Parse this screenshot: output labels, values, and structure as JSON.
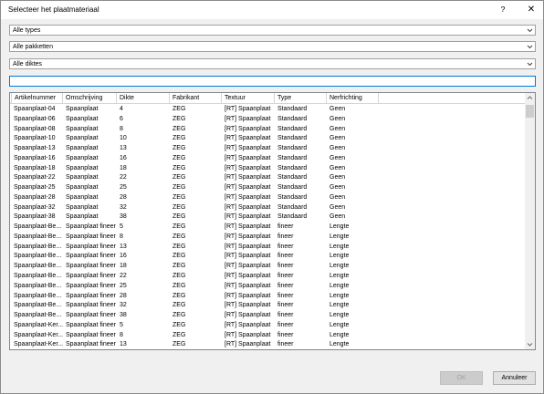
{
  "window": {
    "title": "Selecteer het plaatmateriaal",
    "help_label": "?",
    "close_label": "✕"
  },
  "filters": {
    "types": "Alle types",
    "packages": "Alle pakketten",
    "thickness": "Alle diktes"
  },
  "search": {
    "value": ""
  },
  "table": {
    "columns": [
      "Artikelnummer",
      "Omschrijving",
      "Dikte",
      "Fabrikant",
      "Textuur",
      "Type",
      "Nerfrichting"
    ],
    "rows": [
      [
        "Spaanplaat-04",
        "Spaanplaat",
        "4",
        "ZEG",
        "[RT] Spaanplaat",
        "Standaard",
        "Geen"
      ],
      [
        "Spaanplaat-06",
        "Spaanplaat",
        "6",
        "ZEG",
        "[RT] Spaanplaat",
        "Standaard",
        "Geen"
      ],
      [
        "Spaanplaat-08",
        "Spaanplaat",
        "8",
        "ZEG",
        "[RT] Spaanplaat",
        "Standaard",
        "Geen"
      ],
      [
        "Spaanplaat-10",
        "Spaanplaat",
        "10",
        "ZEG",
        "[RT] Spaanplaat",
        "Standaard",
        "Geen"
      ],
      [
        "Spaanplaat-13",
        "Spaanplaat",
        "13",
        "ZEG",
        "[RT] Spaanplaat",
        "Standaard",
        "Geen"
      ],
      [
        "Spaanplaat-16",
        "Spaanplaat",
        "16",
        "ZEG",
        "[RT] Spaanplaat",
        "Standaard",
        "Geen"
      ],
      [
        "Spaanplaat-18",
        "Spaanplaat",
        "18",
        "ZEG",
        "[RT] Spaanplaat",
        "Standaard",
        "Geen"
      ],
      [
        "Spaanplaat-22",
        "Spaanplaat",
        "22",
        "ZEG",
        "[RT] Spaanplaat",
        "Standaard",
        "Geen"
      ],
      [
        "Spaanplaat-25",
        "Spaanplaat",
        "25",
        "ZEG",
        "[RT] Spaanplaat",
        "Standaard",
        "Geen"
      ],
      [
        "Spaanplaat-28",
        "Spaanplaat",
        "28",
        "ZEG",
        "[RT] Spaanplaat",
        "Standaard",
        "Geen"
      ],
      [
        "Spaanplaat-32",
        "Spaanplaat",
        "32",
        "ZEG",
        "[RT] Spaanplaat",
        "Standaard",
        "Geen"
      ],
      [
        "Spaanplaat-38",
        "Spaanplaat",
        "38",
        "ZEG",
        "[RT] Spaanplaat",
        "Standaard",
        "Geen"
      ],
      [
        "Spaanplaat-Be...",
        "Spaanplaat fineer",
        "5",
        "ZEG",
        "[RT] Spaanplaat",
        "fineer",
        "Lengte"
      ],
      [
        "Spaanplaat-Be...",
        "Spaanplaat fineer",
        "8",
        "ZEG",
        "[RT] Spaanplaat",
        "fineer",
        "Lengte"
      ],
      [
        "Spaanplaat-Be...",
        "Spaanplaat fineer",
        "13",
        "ZEG",
        "[RT] Spaanplaat",
        "fineer",
        "Lengte"
      ],
      [
        "Spaanplaat-Be...",
        "Spaanplaat fineer",
        "16",
        "ZEG",
        "[RT] Spaanplaat",
        "fineer",
        "Lengte"
      ],
      [
        "Spaanplaat-Be...",
        "Spaanplaat fineer",
        "18",
        "ZEG",
        "[RT] Spaanplaat",
        "fineer",
        "Lengte"
      ],
      [
        "Spaanplaat-Be...",
        "Spaanplaat fineer",
        "22",
        "ZEG",
        "[RT] Spaanplaat",
        "fineer",
        "Lengte"
      ],
      [
        "Spaanplaat-Be...",
        "Spaanplaat fineer",
        "25",
        "ZEG",
        "[RT] Spaanplaat",
        "fineer",
        "Lengte"
      ],
      [
        "Spaanplaat-Be...",
        "Spaanplaat fineer",
        "28",
        "ZEG",
        "[RT] Spaanplaat",
        "fineer",
        "Lengte"
      ],
      [
        "Spaanplaat-Be...",
        "Spaanplaat fineer",
        "32",
        "ZEG",
        "[RT] Spaanplaat",
        "fineer",
        "Lengte"
      ],
      [
        "Spaanplaat-Be...",
        "Spaanplaat fineer",
        "38",
        "ZEG",
        "[RT] Spaanplaat",
        "fineer",
        "Lengte"
      ],
      [
        "Spaanplaat-Ker...",
        "Spaanplaat fineer",
        "5",
        "ZEG",
        "[RT] Spaanplaat",
        "fineer",
        "Lengte"
      ],
      [
        "Spaanplaat-Ker...",
        "Spaanplaat fineer",
        "8",
        "ZEG",
        "[RT] Spaanplaat",
        "fineer",
        "Lengte"
      ],
      [
        "Spaanplaat-Ker...",
        "Spaanplaat fineer",
        "13",
        "ZEG",
        "[RT] Spaanplaat",
        "fineer",
        "Lengte"
      ]
    ]
  },
  "buttons": {
    "ok": "OK",
    "cancel": "Annuleer"
  }
}
